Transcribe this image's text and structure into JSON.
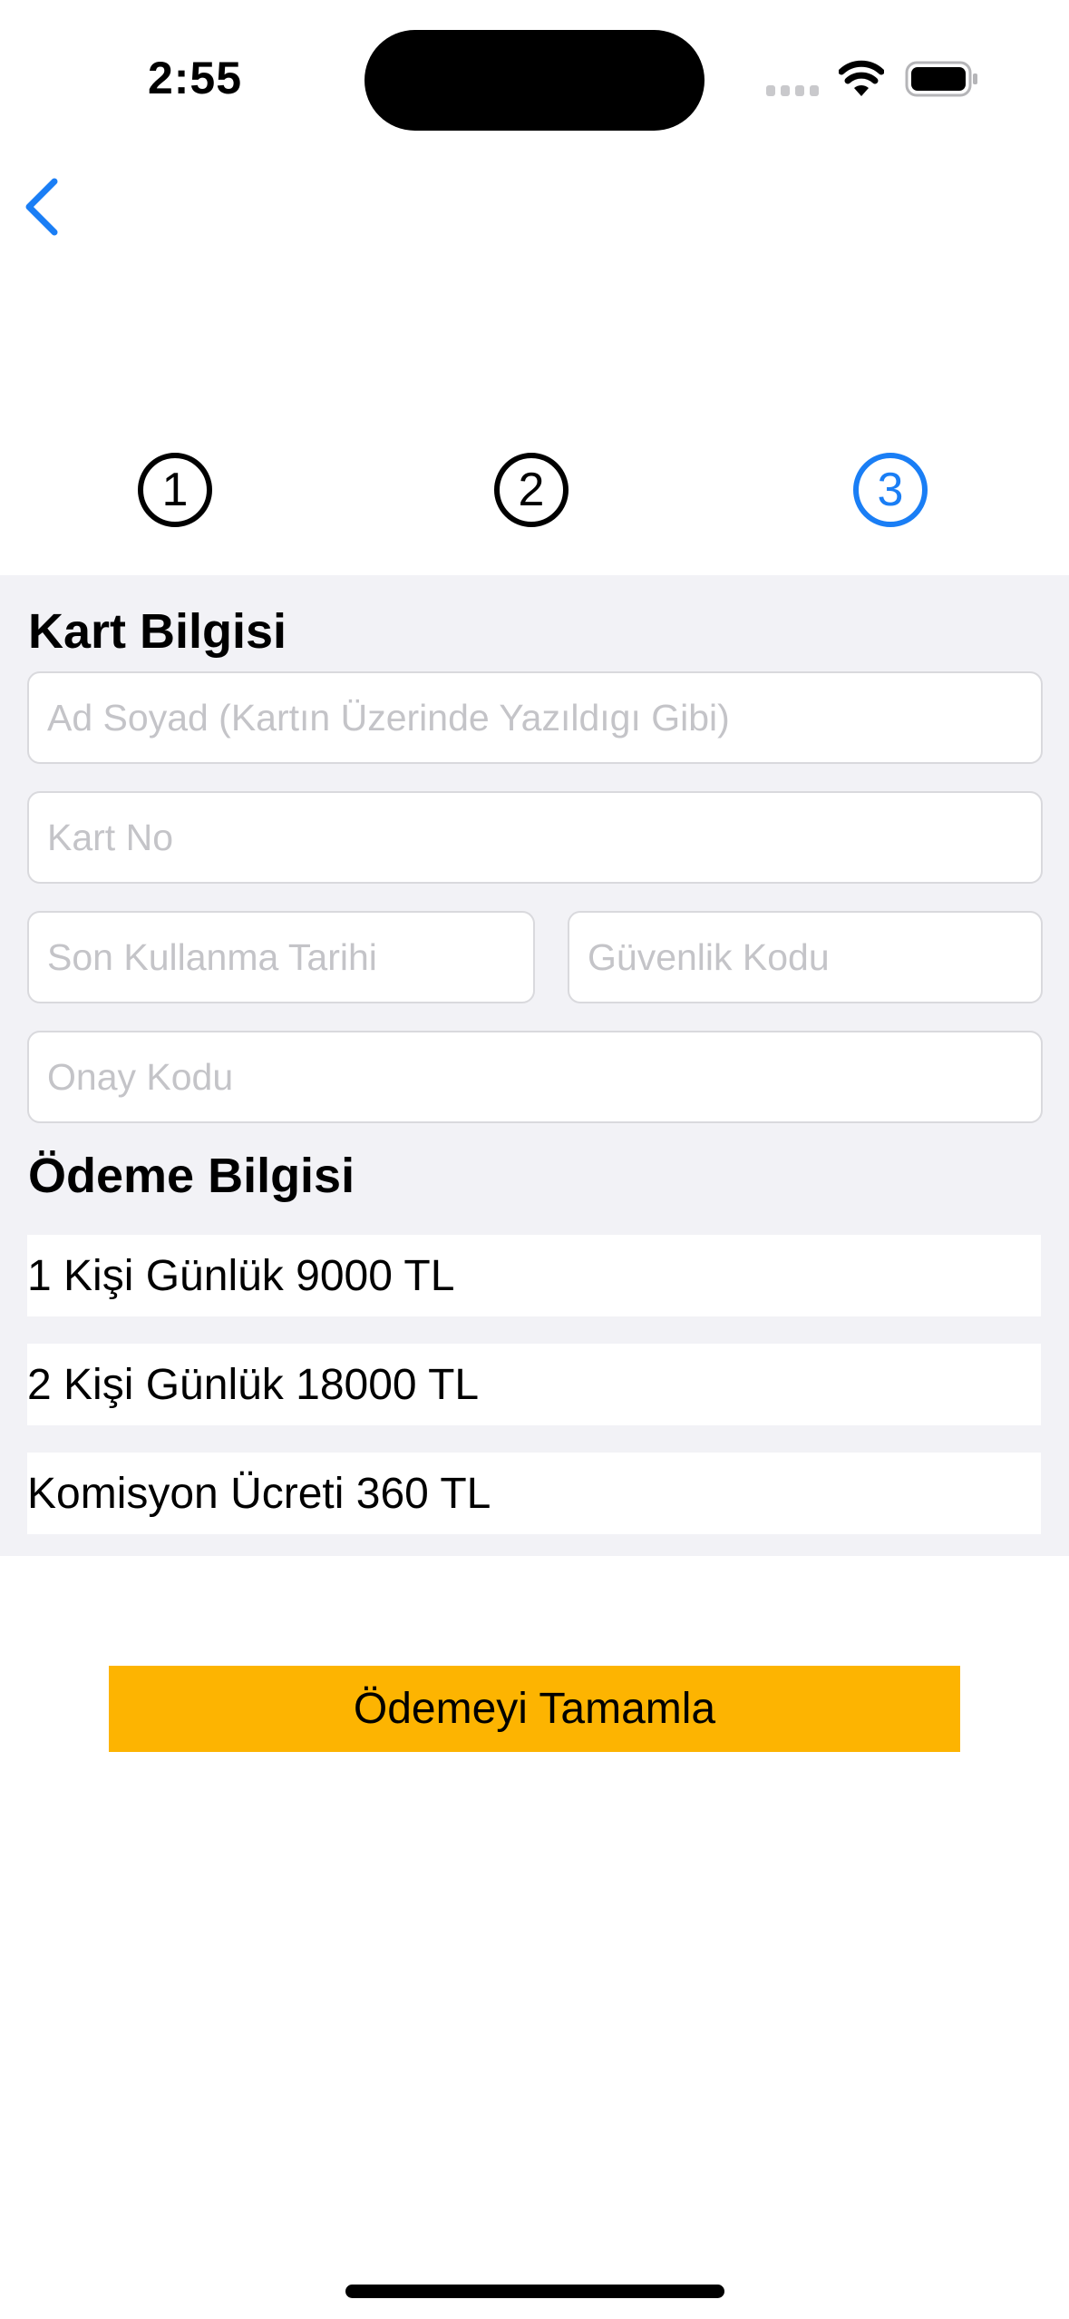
{
  "status_bar": {
    "time": "2:55"
  },
  "nav": {
    "back_icon": "chevron-left-icon"
  },
  "steps": [
    {
      "label": "1",
      "active": false
    },
    {
      "label": "2",
      "active": false
    },
    {
      "label": "3",
      "active": true
    }
  ],
  "card_section": {
    "title": "Kart Bilgisi",
    "name_placeholder": "Ad Soyad (Kartın Üzerinde Yazıldıgı Gibi)",
    "card_no_placeholder": "Kart No",
    "expiry_placeholder": "Son Kullanma Tarihi",
    "cvv_placeholder": "Güvenlik Kodu",
    "confirm_placeholder": "Onay Kodu"
  },
  "payment_section": {
    "title": "Ödeme Bilgisi",
    "rows": [
      "1 Kişi Günlük 9000 TL",
      "2 Kişi Günlük 18000 TL",
      "Komisyon Ücreti 360 TL"
    ]
  },
  "actions": {
    "complete_label": "Ödemeyi Tamamla"
  },
  "colors": {
    "accent": "#1a7ef5",
    "button": "#fdb401",
    "panel_bg": "#f2f2f6"
  }
}
